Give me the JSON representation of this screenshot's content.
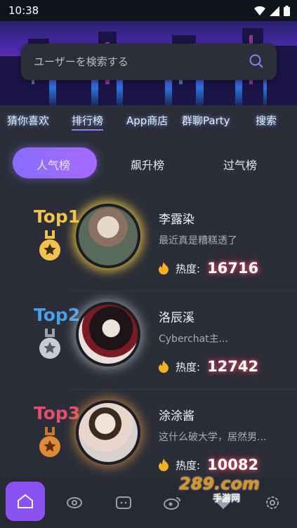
{
  "status_bar": {
    "time": "10:38"
  },
  "search": {
    "placeholder": "ユーザーを検索する"
  },
  "top_tabs": [
    "猜你喜欢",
    "排行榜",
    "App商店",
    "群聊Party",
    "搜索"
  ],
  "active_top_tab": "排行榜",
  "segments": [
    "人气榜",
    "飙升榜",
    "过气榜"
  ],
  "active_segment": "人气榜",
  "rankings": [
    {
      "rank": "Top1",
      "name": "李露染",
      "desc": "最近真是糟糕透了",
      "heat_label": "热度:",
      "heat": "16716",
      "color": "#f3c24a"
    },
    {
      "rank": "Top2",
      "name": "洛辰溪",
      "desc": "Cyberchat主...",
      "heat_label": "热度:",
      "heat": "12742",
      "color": "#4aa0e8"
    },
    {
      "rank": "Top3",
      "name": "涂涂酱",
      "desc": "这什么破大学，居然男...",
      "heat_label": "热度:",
      "heat": "10082",
      "color": "#e0506a"
    }
  ],
  "bottom_nav": [
    "home-icon",
    "eye-icon",
    "chat-icon",
    "weibo-icon",
    "heart-icon",
    "gear-icon"
  ],
  "watermark": {
    "brand": "289.com",
    "sub": "手游网"
  }
}
